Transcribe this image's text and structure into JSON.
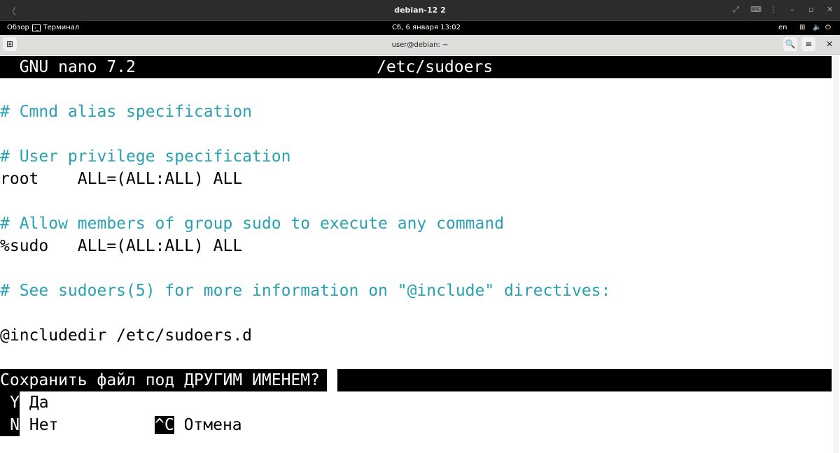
{
  "vm": {
    "title": "debian-12 2",
    "back": "〈",
    "icons": [
      "fullscreen-icon",
      "keyboard-icon",
      "more-icon",
      "minimize-icon",
      "restore-icon",
      "close-icon"
    ]
  },
  "gnome": {
    "overview": "Обзор",
    "app": "Терминал",
    "clock": "Сб, 6 января  13:02",
    "lang": "en"
  },
  "terminal": {
    "title": "user@debian: ~"
  },
  "nano": {
    "header_app": "GNU nano 7.2",
    "header_file": "/etc/sudoers",
    "lines": [
      "",
      "# Cmnd alias specification",
      "",
      "# User privilege specification",
      "root    ALL=(ALL:ALL) ALL",
      "",
      "# Allow members of group sudo to execute any command",
      "%sudo   ALL=(ALL:ALL) ALL",
      "",
      "# See sudoers(5) for more information on \"@include\" directives:",
      "",
      "@includedir /etc/sudoers.d",
      ""
    ],
    "prompt": "Сохранить файл под ДРУГИМ ИМЕНЕМ?",
    "options": {
      "yes_key": "Y",
      "yes": "Да",
      "no_key": "N",
      "no": "Нет",
      "cancel_key": "^C",
      "cancel": "Отмена"
    },
    "comment_color": "#2aa1b3"
  }
}
